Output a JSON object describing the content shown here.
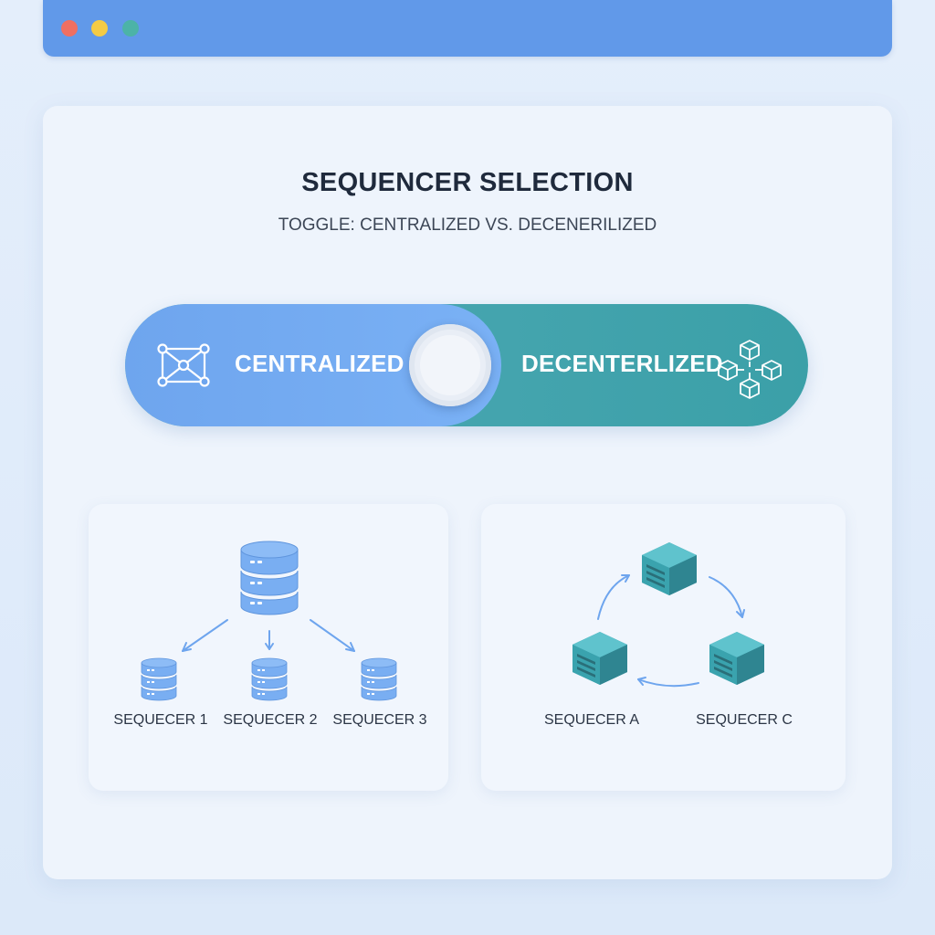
{
  "window": {
    "controls": [
      "red",
      "yellow",
      "green"
    ],
    "accent": "#6199e9"
  },
  "header": {
    "title": "SEQUENCER SELECTION",
    "subtitle": "TOGGLE: CENTRALIZED VS. DECENERILIZED"
  },
  "toggle": {
    "left_label": "CENTRALIZED",
    "right_label": "DECENTERLIZED",
    "left_icon": "network-hub-icon",
    "right_icon": "distributed-cubes-icon",
    "left_color": "#6ea5ee",
    "right_color": "#3ba0a8"
  },
  "centralized_panel": {
    "hub_icon": "database-icon",
    "nodes": [
      "SEQUECER 1",
      "SEQUECER 2",
      "SEQUECER 3"
    ]
  },
  "decentralized_panel": {
    "node_icon": "cube-server-icon",
    "nodes": [
      "SEQUECER A",
      "SEQUECER C"
    ]
  }
}
